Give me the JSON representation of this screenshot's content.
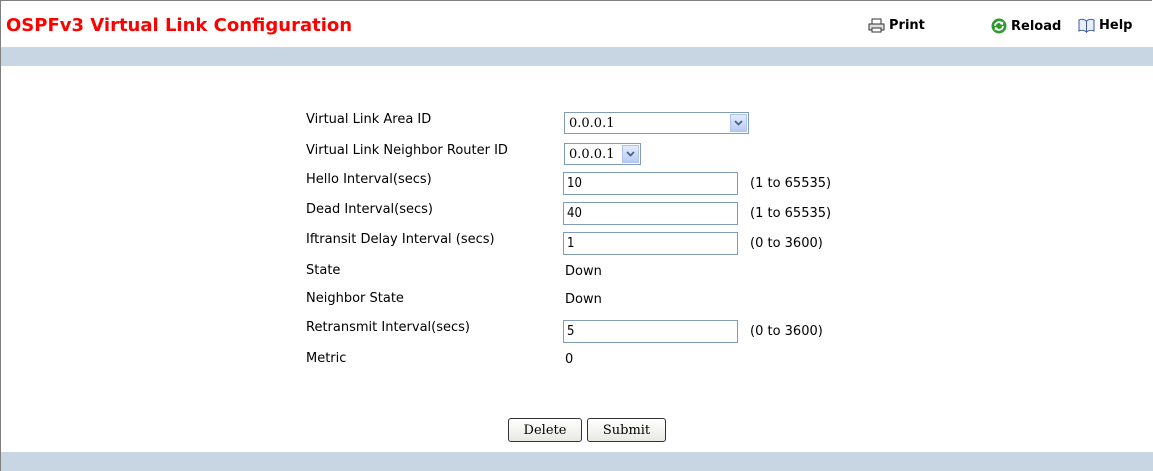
{
  "header": {
    "title": "OSPFv3 Virtual Link Configuration",
    "print_label": "Print",
    "reload_label": "Reload",
    "help_label": "Help"
  },
  "colors": {
    "title": "#ff0000",
    "band": "#c8d5e3",
    "reload_icon": "#2e9b2e"
  },
  "icons": {
    "print": "printer-icon",
    "reload": "reload-icon",
    "help": "book-icon"
  },
  "form": {
    "area_id": {
      "label": "Virtual Link Area ID",
      "value": "0.0.0.1"
    },
    "neighbor_router_id": {
      "label": "Virtual Link Neighbor Router ID",
      "value": "0.0.0.1"
    },
    "hello_interval": {
      "label": "Hello Interval(secs)",
      "value": "10",
      "range": "(1 to 65535)"
    },
    "dead_interval": {
      "label": "Dead Interval(secs)",
      "value": "40",
      "range": "(1 to 65535)"
    },
    "iftransit_delay": {
      "label": "Iftransit Delay Interval (secs)",
      "value": "1",
      "range": "(0 to 3600)"
    },
    "state": {
      "label": "State",
      "value": "Down"
    },
    "neighbor_state": {
      "label": "Neighbor State",
      "value": "Down"
    },
    "retransmit_interval": {
      "label": "Retransmit Interval(secs)",
      "value": "5",
      "range": "(0 to 3600)"
    },
    "metric": {
      "label": "Metric",
      "value": "0"
    }
  },
  "buttons": {
    "delete": "Delete",
    "submit": "Submit"
  }
}
